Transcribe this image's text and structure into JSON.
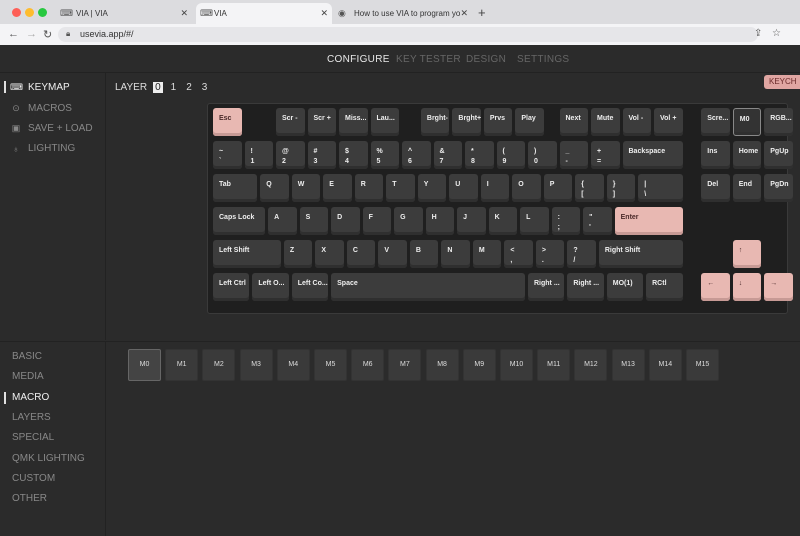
{
  "browser": {
    "tabs": [
      {
        "label": "VIA | VIA",
        "active": false
      },
      {
        "label": "VIA",
        "active": true
      },
      {
        "label": "How to use VIA to program yo",
        "active": false
      }
    ],
    "new_tab": "+",
    "url": "usevia.app/#/"
  },
  "topnav": {
    "items": [
      "CONFIGURE",
      "KEY TESTER",
      "DESIGN",
      "SETTINGS"
    ],
    "active": "CONFIGURE"
  },
  "keychip_label": "KEYCH",
  "sidebar": {
    "items": [
      {
        "label": "KEYMAP",
        "icon": "keyboard-icon",
        "active": true
      },
      {
        "label": "MACROS",
        "icon": "record-icon",
        "active": false
      },
      {
        "label": "SAVE + LOAD",
        "icon": "save-icon",
        "active": false
      },
      {
        "label": "LIGHTING",
        "icon": "bulb-icon",
        "active": false
      }
    ]
  },
  "layer": {
    "label": "LAYER",
    "options": [
      "0",
      "1",
      "2",
      "3"
    ],
    "selected": "0"
  },
  "keyboard": {
    "rows": [
      [
        {
          "l": "Esc",
          "pink": true
        },
        {
          "l": "Scr -"
        },
        {
          "l": "Scr +"
        },
        {
          "l": "Miss..."
        },
        {
          "l": "Lau..."
        },
        {
          "l": "Brght-"
        },
        {
          "l": "Brght+"
        },
        {
          "l": "Prvs"
        },
        {
          "l": "Play"
        },
        {
          "l": "Next"
        },
        {
          "l": "Mute"
        },
        {
          "l": "Vol -"
        },
        {
          "l": "Vol +"
        },
        {
          "l": "Scre..."
        },
        {
          "l": "M0",
          "sel": true
        },
        {
          "l": "RGB..."
        }
      ],
      [
        {
          "l": "~",
          "s": "`"
        },
        {
          "l": "!",
          "s": "1"
        },
        {
          "l": "@",
          "s": "2"
        },
        {
          "l": "#",
          "s": "3"
        },
        {
          "l": "$",
          "s": "4"
        },
        {
          "l": "%",
          "s": "5"
        },
        {
          "l": "^",
          "s": "6"
        },
        {
          "l": "&",
          "s": "7"
        },
        {
          "l": "*",
          "s": "8"
        },
        {
          "l": "(",
          "s": "9"
        },
        {
          "l": ")",
          "s": "0"
        },
        {
          "l": "_",
          "s": "-"
        },
        {
          "l": "+",
          "s": "="
        },
        {
          "l": "Backspace"
        },
        {
          "l": "Ins"
        },
        {
          "l": "Home"
        },
        {
          "l": "PgUp"
        }
      ],
      [
        {
          "l": "Tab"
        },
        {
          "l": "Q"
        },
        {
          "l": "W"
        },
        {
          "l": "E"
        },
        {
          "l": "R"
        },
        {
          "l": "T"
        },
        {
          "l": "Y"
        },
        {
          "l": "U"
        },
        {
          "l": "I"
        },
        {
          "l": "O"
        },
        {
          "l": "P"
        },
        {
          "l": "{",
          "s": "["
        },
        {
          "l": "}",
          "s": "]"
        },
        {
          "l": "|",
          "s": "\\"
        },
        {
          "l": "Del"
        },
        {
          "l": "End"
        },
        {
          "l": "PgDn"
        }
      ],
      [
        {
          "l": "Caps Lock"
        },
        {
          "l": "A"
        },
        {
          "l": "S"
        },
        {
          "l": "D"
        },
        {
          "l": "F"
        },
        {
          "l": "G"
        },
        {
          "l": "H"
        },
        {
          "l": "J"
        },
        {
          "l": "K"
        },
        {
          "l": "L"
        },
        {
          "l": ":",
          "s": ";"
        },
        {
          "l": "\"",
          "s": "'"
        },
        {
          "l": "Enter",
          "pink": true
        }
      ],
      [
        {
          "l": "Left Shift"
        },
        {
          "l": "Z"
        },
        {
          "l": "X"
        },
        {
          "l": "C"
        },
        {
          "l": "V"
        },
        {
          "l": "B"
        },
        {
          "l": "N"
        },
        {
          "l": "M"
        },
        {
          "l": "<",
          "s": ","
        },
        {
          "l": ">",
          "s": "."
        },
        {
          "l": "?",
          "s": "/"
        },
        {
          "l": "Right Shift"
        },
        {
          "l": "↑",
          "pink": true
        }
      ],
      [
        {
          "l": "Left Ctrl"
        },
        {
          "l": "Left O..."
        },
        {
          "l": "Left Co..."
        },
        {
          "l": "Space"
        },
        {
          "l": "Right ..."
        },
        {
          "l": "Right ..."
        },
        {
          "l": "MO(1)"
        },
        {
          "l": "RCtl"
        },
        {
          "l": "←",
          "pink": true
        },
        {
          "l": "↓",
          "pink": true
        },
        {
          "l": "→",
          "pink": true
        }
      ]
    ]
  },
  "categories": {
    "items": [
      "BASIC",
      "MEDIA",
      "MACRO",
      "LAYERS",
      "SPECIAL",
      "QMK LIGHTING",
      "CUSTOM",
      "OTHER"
    ],
    "active": "MACRO"
  },
  "macro_keys": [
    "M0",
    "M1",
    "M2",
    "M3",
    "M4",
    "M5",
    "M6",
    "M7",
    "M8",
    "M9",
    "M10",
    "M11",
    "M12",
    "M13",
    "M14",
    "M15"
  ],
  "colors": {
    "accent": "#e8b8b2",
    "background": "#2b2b2b"
  }
}
